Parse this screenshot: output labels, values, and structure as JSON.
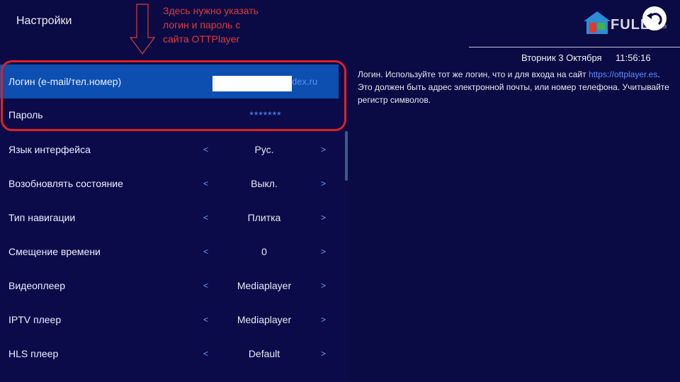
{
  "header": {
    "title": "Настройки"
  },
  "annotation": {
    "lines": [
      "Здесь нужно указать",
      "логин и пароль с",
      "сайта OTTPlayer"
    ]
  },
  "logo": {
    "brand": "FULL",
    "suffix": ".am"
  },
  "status": {
    "date": "Вторник 3 Октября",
    "time": "11:56:16"
  },
  "settings": {
    "login": {
      "label": "Логин (e-mail/тел.номер)",
      "value_tail": "dex.ru"
    },
    "password": {
      "label": "Пароль",
      "value": "*******"
    },
    "rows": [
      {
        "label": "Язык интерфейса",
        "value": "Рус."
      },
      {
        "label": "Возобновлять состояние",
        "value": "Выкл."
      },
      {
        "label": "Тип навигации",
        "value": "Плитка"
      },
      {
        "label": "Смещение времени",
        "value": "0"
      },
      {
        "label": "Видеоплеер",
        "value": "Mediaplayer"
      },
      {
        "label": "IPTV плеер",
        "value": "Mediaplayer"
      },
      {
        "label": "HLS плеер",
        "value": "Default"
      }
    ],
    "prev_symbol": "<",
    "next_symbol": ">"
  },
  "help": {
    "text_before_link": "Логин. Используйте тот же логин, что и для входа на сайт ",
    "link": "https://ottplayer.es",
    "text_after_link": ". Это должен быть адрес электронной почты, или номер телефона. Учитывайте регистр символов."
  },
  "colors": {
    "background": "#0a0a44",
    "selected": "#0c4fb0",
    "accent": "#5a90ff",
    "annotation": "#e03a3a"
  }
}
